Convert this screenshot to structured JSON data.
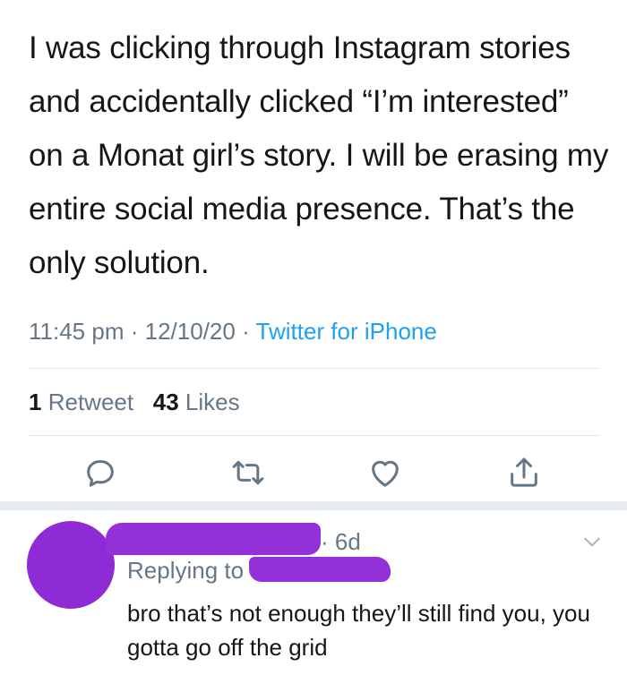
{
  "tweet": {
    "text": "I was clicking through Instagram stories and accidentally clicked “I’m interested” on a Monat girl’s story. I will be erasing my entire social media presence. That’s the only solution.",
    "time": "11:45 pm",
    "separator": "·",
    "date": "12/10/20",
    "source": "Twitter for iPhone"
  },
  "stats": {
    "retweet_count": "1",
    "retweet_label": "Retweet",
    "like_count": "43",
    "like_label": "Likes"
  },
  "actions": {
    "icons": [
      "reply-icon",
      "retweet-icon",
      "like-icon",
      "share-icon"
    ],
    "icon_color": "#657786"
  },
  "reply": {
    "time": "· 6d",
    "replying_to": "Replying to",
    "text": "bro that’s not enough they’ll still find you, you gotta go off the grid",
    "scribble_color": "#9430d8"
  },
  "colors": {
    "link": "#1da1f2",
    "muted": "#657786",
    "text": "#14171a",
    "divider": "#e1e8ed"
  }
}
